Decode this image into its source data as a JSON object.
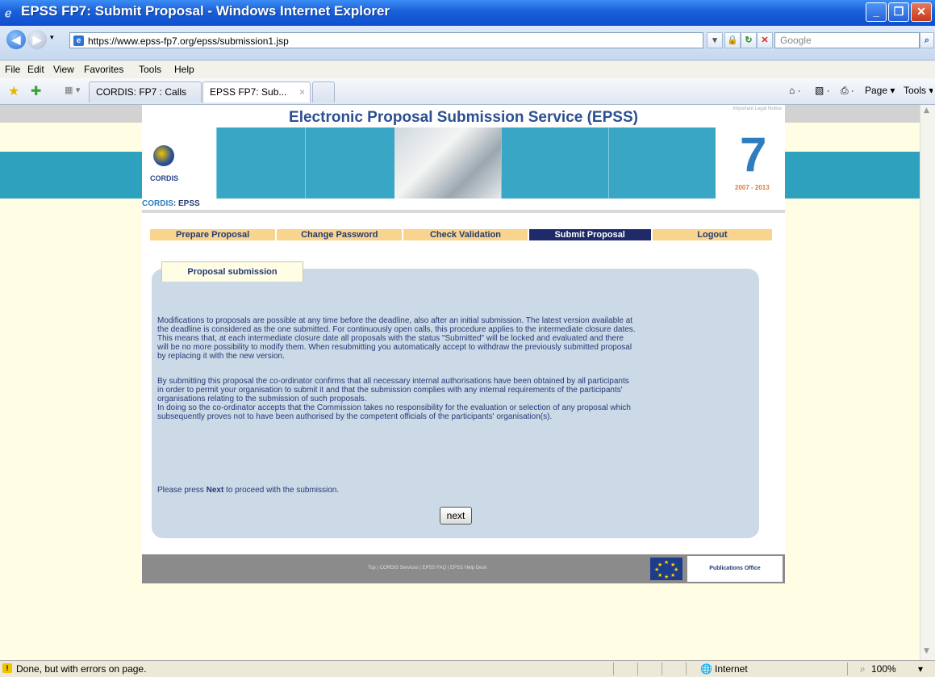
{
  "window": {
    "title": "EPSS FP7: Submit Proposal - Windows Internet Explorer",
    "minimize": "_",
    "maximize": "❐",
    "close": "✕"
  },
  "address": {
    "url": "https://www.epss-fp7.org/epss/submission1.jsp",
    "search_placeholder": "Google"
  },
  "menu": {
    "file": "File",
    "edit": "Edit",
    "view": "View",
    "favorites": "Favorites",
    "tools": "Tools",
    "help": "Help"
  },
  "tabs": [
    {
      "label": "CORDIS: FP7 : Calls"
    },
    {
      "label": "EPSS FP7: Sub...",
      "close": "×"
    }
  ],
  "toolbar": {
    "page": "Page ▾",
    "tools": "Tools ▾"
  },
  "site": {
    "header_title": "Electronic Proposal Submission Service (EPSS)",
    "legal": "Important Legal Notice",
    "cordis_logo_text": "CORDIS",
    "fp7_years": "2007 - 2013",
    "breadcrumb_link": "CORDIS",
    "breadcrumb_current": ": EPSS",
    "nav": [
      {
        "label": "Prepare Proposal"
      },
      {
        "label": "Change Password"
      },
      {
        "label": "Check Validation"
      },
      {
        "label": "Submit Proposal"
      },
      {
        "label": "Logout"
      }
    ],
    "panel_tab": "Proposal submission",
    "para1": "Modifications to proposals are possible at any time before the deadline, also after an initial submission. The latest version available at\nthe deadline is considered as the one submitted. For continuously open calls, this procedure applies to the intermediate closure dates.\nThis means that, at each intermediate closure date all proposals with the status \"Submitted\" will be locked and evaluated and there\nwill be no more possibility to modify them. When resubmitting you automatically accept to withdraw the previously submitted proposal\nby replacing it with the new version.",
    "para2": "By submitting this proposal the co-ordinator confirms that all necessary internal authorisations have been obtained by all participants\nin order to permit your organisation to submit it and that the submission complies with any internal requirements of the participants'\norganisations relating to the submission of such proposals.\nIn doing so the co-ordinator accepts that the Commission takes no responsibility for the evaluation or selection of any proposal which\nsubsequently proves not to have been authorised by the competent officials of the participants' organisation(s).",
    "press_prefix": "Please press ",
    "press_bold": "Next",
    "press_suffix": " to proceed with the submission.",
    "next_button": "next",
    "footer_links": "Top | CORDIS Services | EPSS FAQ | EPSS Help Desk",
    "publications_office": "Publications Office"
  },
  "status": {
    "text": "Done, but with errors on page.",
    "zone": "Internet",
    "zoom": "100%"
  },
  "colors": {
    "teal": "#2ea1bf",
    "nav_bg": "#f8d48e",
    "nav_selected": "#1e2a6a",
    "panel": "#ccd9e6",
    "page_bg": "#fffde4"
  }
}
